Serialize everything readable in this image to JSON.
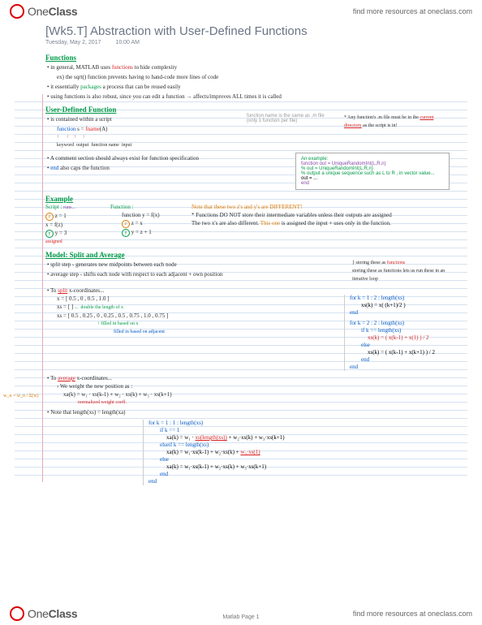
{
  "header": {
    "logo1": "One",
    "logo2": "Class",
    "link": "find more resources at oneclass.com"
  },
  "title": "[Wk5.T] Abstraction with User-Defined Functions",
  "meta": {
    "date": "Tuesday, May 2, 2017",
    "time": "10:00 AM"
  },
  "s1": {
    "head": "Functions",
    "b1a": "in general, MATLAB uses ",
    "b1b": "functions",
    "b1c": " to hide complexity",
    "b2": "ex) the sqrt() function prevents having to hand-code more lines of code",
    "b3a": "it essentially ",
    "b3b": "packages",
    "b3c": " a process that can be reused easily",
    "b4": "using functions is also robust, since you can edit a function → affects/improves ALL times it is called"
  },
  "s2": {
    "head": "User-Defined Function",
    "b1": "is contained within a script",
    "code": "function s = fname(A)",
    "lab1": "keyword",
    "lab2": "output",
    "lab3": "function name",
    "lab4": "input",
    "note_fn": "function name is the same as .m file (only 1 function per file)",
    "star1": "* Any function's .m file must be in the ",
    "star1b": "current directory",
    "star1c": " as the script is in!",
    "b2": "A comment section should always exist for function specification",
    "b3a": "end",
    "b3b": " also caps the function",
    "ex_head": "An example:",
    "ex1": "function out = UniqueRandomInt(L,R,n)",
    "ex2": "% out = UniqueRandomInt(L,R,n)",
    "ex3": "% output a unique sequence such as L to R , in vector value...",
    "ex4": "out = ...",
    "ex5": "end"
  },
  "s3": {
    "head": "Example",
    "script_h": "Script :",
    "func_h": "Function :",
    "runs": "runs...",
    "sc1": "z = 1",
    "sc2": "x = f(z)",
    "sc3": "y = 3",
    "fn1": "function y = f(x)",
    "fn2": "z = x",
    "fn3": "y = z + 1",
    "assigned": "assigned",
    "note1": "Note that these two z's and y's are DIFFERENT!",
    "note2": "* Functions DO NOT store their intermediate variables unless their outputs are assigned",
    "note3": "The two x's are also different. This one is assigned the input + uses only in the function."
  },
  "s4": {
    "head": "Model: Split and Average",
    "sp1": "split step   -  generates new midpoints between each node",
    "sp2": "average step - shifts each node with respect to each adjacent + own position",
    "store": "storing these as functions lets us run these in an iterative loop",
    "split_h": "To split x-coordinates...",
    "x1": "x = [ 0.5 , 0 , 0.5 , 1.0 ]",
    "x2": "xs = [ ] ← double the length of x",
    "x3": "xs = [ 0.5 , 0.25 , 0 , 0.25 , 0.5 , 0.75 , 1.0 , 0.75 ]",
    "filled1": "filled in based on x",
    "filled2": "filled in based on adjacent",
    "for1a": "for k = 1 : 2 : length(xs)",
    "for1b": "xs(k) = x( (k+1)/2 )",
    "for1c": "end",
    "for2a": "for k = 2 : 2 : length(xs)",
    "for2b": "if k == length(xs)",
    "for2c": "xs(k) = ( x(k-1) + x(1) ) / 2",
    "for2d": "else",
    "for2e": "xs(k) = ( x(k-1) + x(k+1) ) / 2",
    "for2f": "end",
    "for2g": "end",
    "avg_h": "To average x-coordinates...",
    "avg1": "We weight the new position as :",
    "avg2": "xa(k) = w₁ · xs(k-1) + w₂ · xs(k) + w₃ · xs(k+1)",
    "avg_note": "normalized weight coeff.",
    "wsum": "w_n = w_n / Σ(w)",
    "len": "Note that length(xs) = length(xa)",
    "for3a": "for k = 1 : 1 : length(xs)",
    "for3b": "if k == 1",
    "for3c": "xa(k) = w₁ · xs(length(xs)) + w₂·xs(k) + w₃·xs(k+1)",
    "for3d": "elseif k == length(xs)",
    "for3e": "xa(k) = w₁·xs(k-1) + w₂·xs(k) + w₃·xs(1)",
    "for3f": "else",
    "for3g": "xa(k) = w₁·xs(k-1) + w₂·xs(k) + w₃·xs(k+1)",
    "for3h": "end",
    "for3i": "end"
  },
  "footer": {
    "page": "Matlab Page 1"
  }
}
